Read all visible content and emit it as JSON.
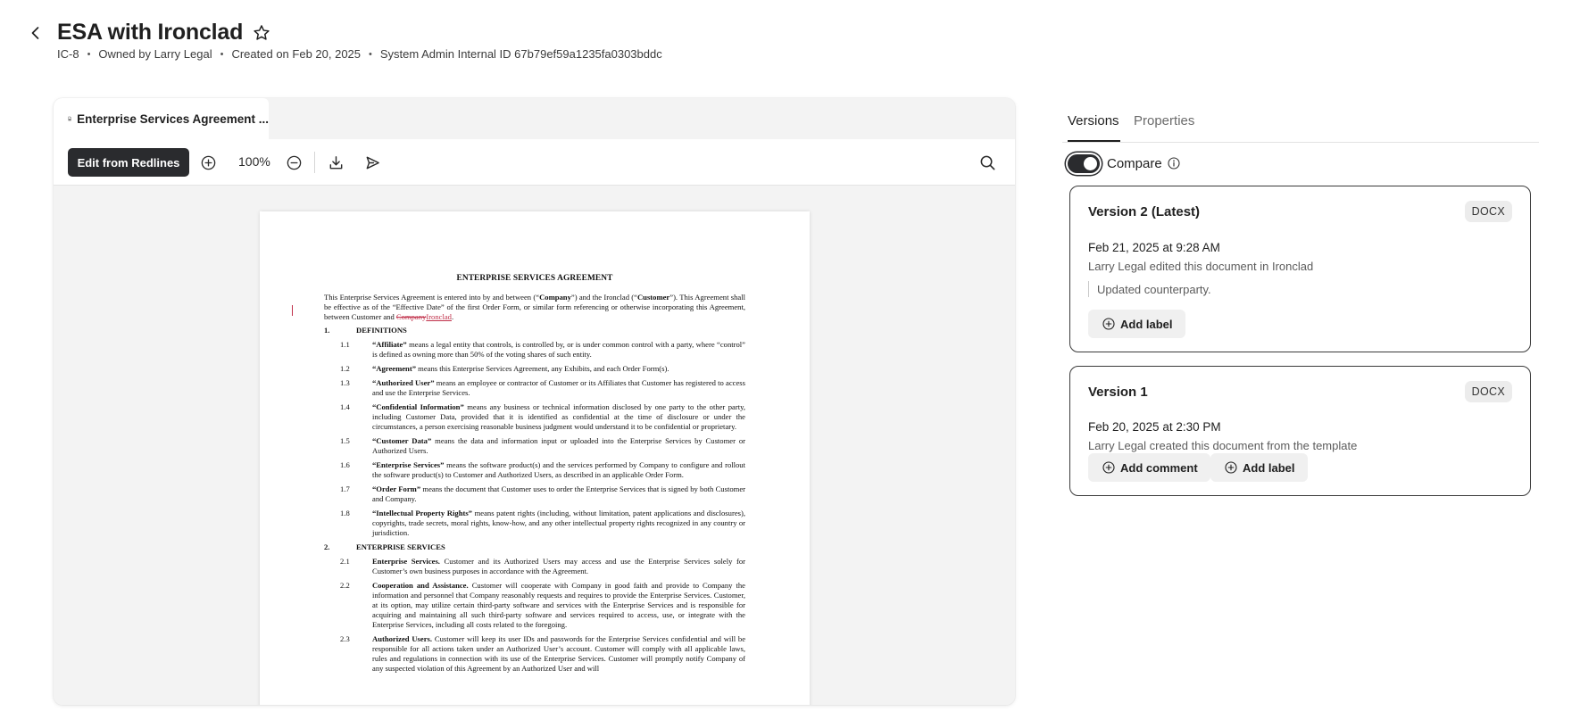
{
  "header": {
    "title": "ESA with Ironclad",
    "meta": [
      "IC-8",
      "Owned by Larry Legal",
      "Created on Feb 20, 2025",
      "System Admin Internal ID 67b79ef59a1235fa0303bddc"
    ]
  },
  "viewer": {
    "tab_label": "Enterprise Services Agreement ...",
    "edit_button": "Edit from Redlines",
    "zoom": "100%"
  },
  "document": {
    "heading": "ENTERPRISE SERVICES AGREEMENT",
    "intro_before": "This Enterprise Services Agreement is entered into by and between  (“",
    "intro_company": "Company",
    "intro_mid": "”) and the Ironclad (“",
    "intro_customer": "Customer",
    "intro_after": "”).  This Agreement shall be effective as of the “Effective Date” of the first Order Form, or similar form referencing or otherwise incorporating this Agreement, between Customer and ",
    "deleted": "Company",
    "inserted": "Ironclad",
    "intro_end": ".",
    "sections": [
      {
        "num": "1.",
        "title": "DEFINITIONS",
        "clauses": [
          {
            "num": "1.1",
            "term": "“Affiliate”",
            "text": " means a legal entity that controls, is controlled by, or is under common control with a party, where “control” is defined as owning more than 50% of the voting shares of such entity."
          },
          {
            "num": "1.2",
            "term": "“Agreement”",
            "text": " means this Enterprise Services Agreement, any Exhibits, and each Order Form(s)."
          },
          {
            "num": "1.3",
            "term": "“Authorized User”",
            "text": " means an employee or contractor of Customer or its Affiliates that Customer has registered to access and use the Enterprise Services."
          },
          {
            "num": "1.4",
            "term": "“Confidential Information”",
            "text": " means any business or technical information disclosed by one party to the other party, including Customer Data, provided that it is identified as confidential at the time of disclosure or under the circumstances, a person exercising reasonable business judgment would understand it to be confidential or proprietary."
          },
          {
            "num": "1.5",
            "term": "“Customer Data”",
            "text": " means the data and information input or uploaded into the Enterprise Services by Customer or Authorized Users."
          },
          {
            "num": "1.6",
            "term": "“Enterprise Services”",
            "text": " means the software product(s) and the services performed by Company to configure and rollout the software product(s) to Customer and Authorized Users, as described in an applicable Order Form."
          },
          {
            "num": "1.7",
            "term": "“Order Form”",
            "text": " means the document that Customer uses to order the Enterprise Services that is signed by both Customer and Company."
          },
          {
            "num": "1.8",
            "term": "“Intellectual Property Rights”",
            "text": " means patent rights (including, without limitation, patent applications and disclosures), copyrights, trade secrets, moral rights, know-how, and any other intellectual property rights recognized in any country or jurisdiction."
          }
        ]
      },
      {
        "num": "2.",
        "title": "ENTERPRISE SERVICES",
        "clauses": [
          {
            "num": "2.1",
            "term": "Enterprise Services.",
            "text": " Customer and its Authorized Users may access and use the Enterprise Services solely for Customer’s own business purposes in accordance with the Agreement."
          },
          {
            "num": "2.2",
            "term": "Cooperation and Assistance.",
            "text": " Customer will cooperate with Company in good faith and provide to Company the information and personnel that Company reasonably requests and requires to provide the Enterprise Services. Customer, at its option, may utilize certain third-party software and services with the Enterprise Services and is responsible for acquiring and maintaining all such third-party software and services required to access, use, or integrate with the Enterprise Services, including all costs related to the foregoing."
          },
          {
            "num": "2.3",
            "term": "Authorized Users.",
            "text": " Customer will keep its user IDs and passwords for the Enterprise Services confidential and will be responsible for all actions taken under an Authorized User’s account. Customer will comply with all applicable laws, rules and regulations in connection with its use of the Enterprise Services. Customer will promptly notify Company of any suspected violation of this Agreement by an Authorized User and will"
          }
        ]
      }
    ]
  },
  "panel": {
    "tabs": [
      "Versions",
      "Properties"
    ],
    "compare_label": "Compare",
    "versions": [
      {
        "title": "Version 2 (Latest)",
        "badge": "DOCX",
        "date": "Feb 21, 2025 at 9:28 AM",
        "desc": "Larry Legal edited this document in Ironclad",
        "note": "Updated counterparty.",
        "buttons": [
          "Add label"
        ]
      },
      {
        "title": "Version 1",
        "badge": "DOCX",
        "date": "Feb 20, 2025 at 2:30 PM",
        "desc": "Larry Legal created this document from the template",
        "buttons": [
          "Add comment",
          "Add label"
        ]
      }
    ]
  }
}
